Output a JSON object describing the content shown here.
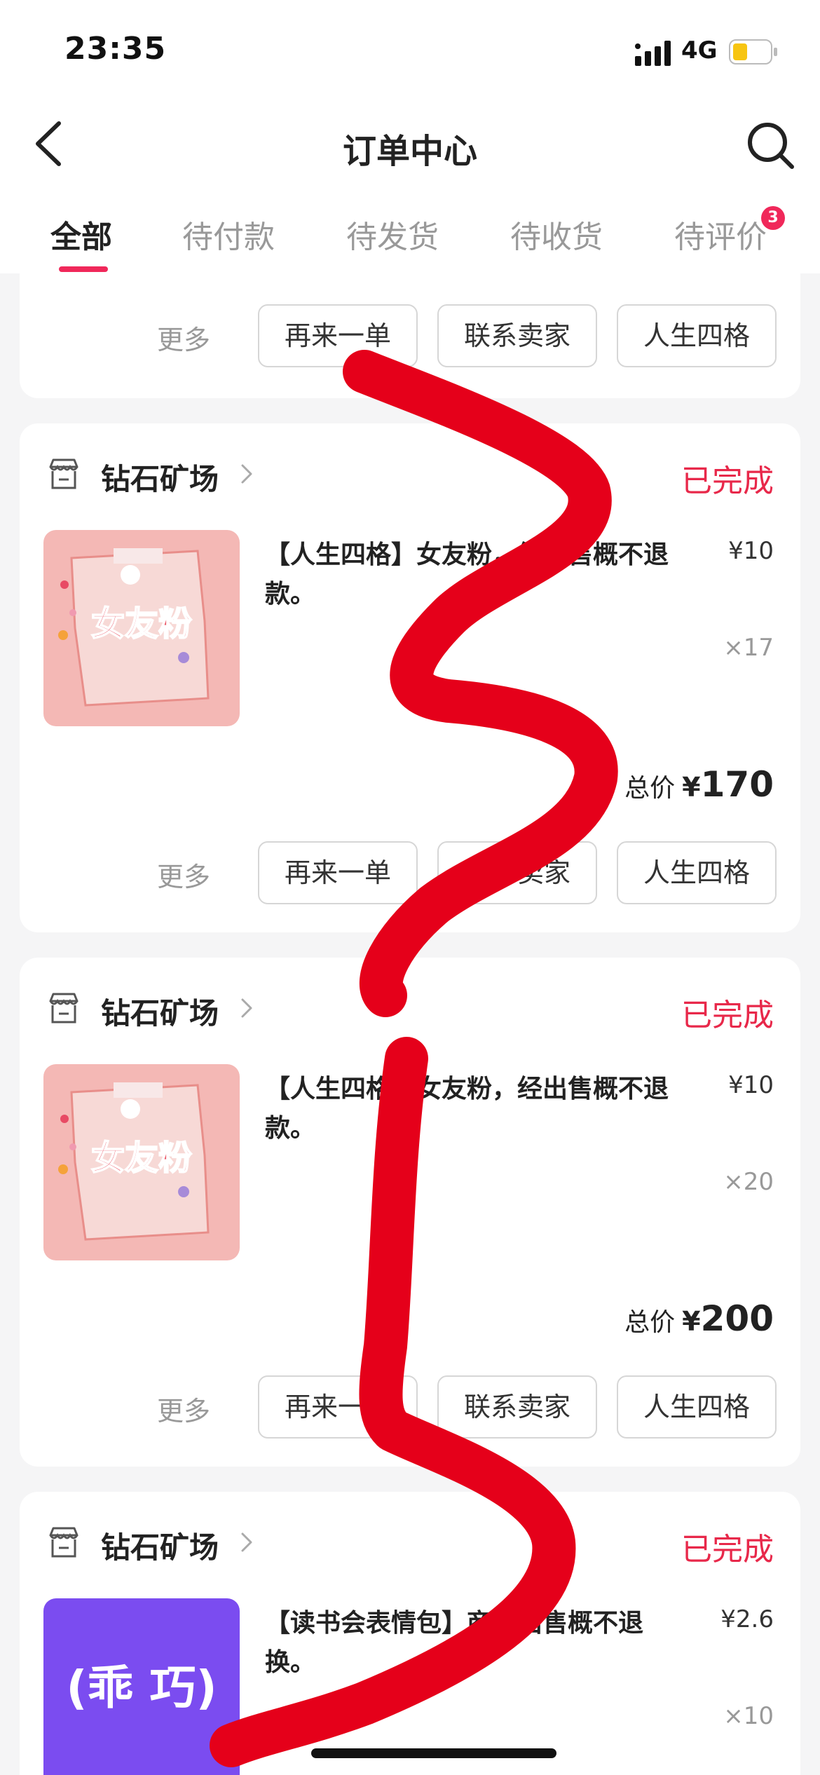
{
  "status_bar": {
    "time": "23:35",
    "network": "4G",
    "signal_icon": "signal-bars-icon",
    "battery_icon": "battery-low-icon",
    "battery_color": "#f7c512"
  },
  "header": {
    "title": "订单中心",
    "back_icon": "chevron-left-icon",
    "search_icon": "search-icon"
  },
  "tabs": [
    {
      "label": "全部",
      "active": true
    },
    {
      "label": "待付款"
    },
    {
      "label": "待发货"
    },
    {
      "label": "待收货"
    },
    {
      "label": "待评价",
      "badge": "3"
    }
  ],
  "colors": {
    "accent": "#f0285a",
    "status_done": "#e8284a",
    "annotation": "#e5001a"
  },
  "partial_card": {
    "more": "更多",
    "buttons": [
      "再来一单",
      "联系卖家",
      "人生四格"
    ]
  },
  "orders": [
    {
      "store": "钻石矿场",
      "status": "已完成",
      "product": "【人生四格】女友粉，经出售概不退款。",
      "price": "¥10",
      "qty": "×17",
      "total_label": "总价",
      "total_currency": "¥",
      "total_amount": "170",
      "thumb_text": "女友粉",
      "more": "更多",
      "buttons": [
        "再来一单",
        "联系卖家",
        "人生四格"
      ]
    },
    {
      "store": "钻石矿场",
      "status": "已完成",
      "product": "【人生四格】女友粉，经出售概不退款。",
      "price": "¥10",
      "qty": "×20",
      "total_label": "总价",
      "total_currency": "¥",
      "total_amount": "200",
      "thumb_text": "女友粉",
      "more": "更多",
      "buttons": [
        "再来一单",
        "联系卖家",
        "人生四格"
      ]
    },
    {
      "store": "钻石矿场",
      "status": "已完成",
      "product": "【读书会表情包】商品出售概不退换。",
      "price": "¥2.6",
      "qty": "×10",
      "thumb_text": "(乖 巧)"
    }
  ]
}
